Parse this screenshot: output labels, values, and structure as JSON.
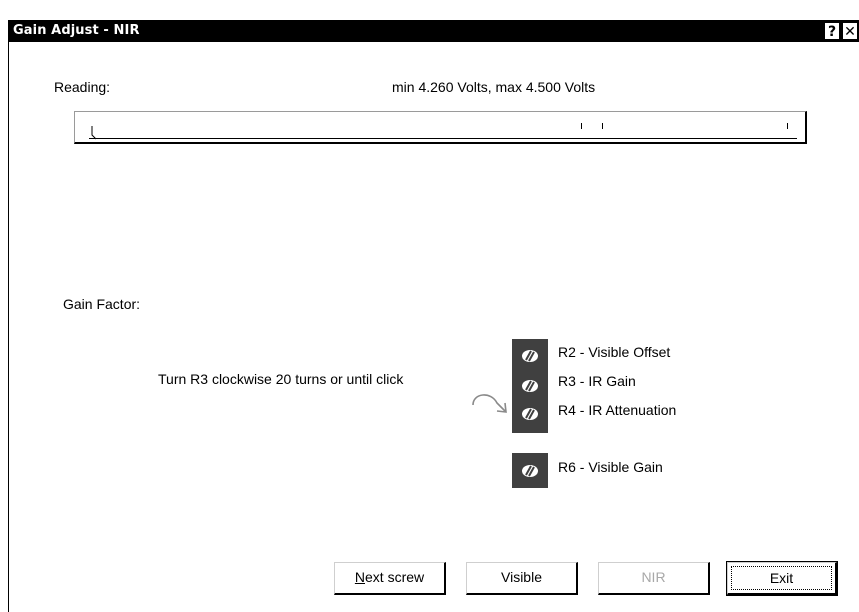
{
  "window": {
    "title": "Gain Adjust - NIR",
    "help_glyph": "?",
    "close_glyph": "✕"
  },
  "reading": {
    "label": "Reading:",
    "range_text": "min 4.260 Volts,  max 4.500 Volts"
  },
  "gain": {
    "label": "Gain Factor:",
    "instruction": "Turn R3 clockwise 20 turns or until click"
  },
  "screws": [
    {
      "label": "R2 - Visible Offset",
      "icon": "screw-icon"
    },
    {
      "label": "R3 - IR Gain",
      "icon": "screw-icon"
    },
    {
      "label": "R4 - IR Attenuation",
      "icon": "screw-icon"
    },
    {
      "label": "R6 - Visible Gain",
      "icon": "screw-icon"
    }
  ],
  "buttons": {
    "next_screw": {
      "label": "Next screw",
      "mnemonic": "N",
      "rest": "ext screw"
    },
    "visible": "Visible",
    "nir": "NIR",
    "exit": "Exit"
  },
  "colors": {
    "titlebar": "#000000",
    "panel": "#404040",
    "disabled_text": "#a8a8a8"
  }
}
